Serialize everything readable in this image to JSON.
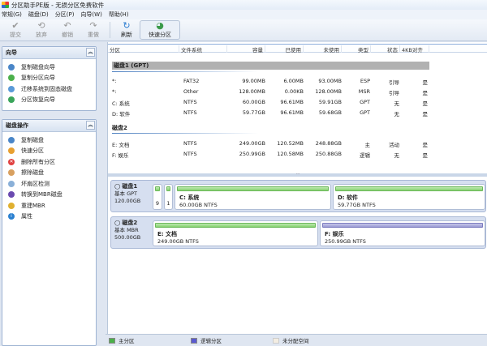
{
  "title": "分区助手PE版 - 无损分区免费软件",
  "menu": [
    "常规(G)",
    "磁盘(D)",
    "分区(P)",
    "向导(W)",
    "帮助(H)"
  ],
  "toolbar": {
    "commit": "提交",
    "discard": "放弃",
    "undo": "撤销",
    "redo": "重做",
    "refresh": "刷新",
    "quick": "快速分区"
  },
  "wizard": {
    "title": "向导",
    "items": [
      "复制磁盘向导",
      "复制分区向导",
      "迁移系统到固态磁盘",
      "分区恢复向导"
    ]
  },
  "diskops": {
    "title": "磁盘操作",
    "items": [
      "复制磁盘",
      "快速分区",
      "删除所有分区",
      "擦除磁盘",
      "坏扇区检测",
      "转换到MBR磁盘",
      "重建MBR",
      "属性"
    ]
  },
  "columns": [
    "分区",
    "文件系统",
    "容量",
    "已使用",
    "未使用",
    "类型",
    "状态",
    "4KB对齐"
  ],
  "disk1": {
    "header": "磁盘1 (GPT)",
    "rows": [
      [
        "*:",
        "FAT32",
        "99.00MB",
        "6.00MB",
        "93.00MB",
        "ESP",
        "引导",
        "是"
      ],
      [
        "*:",
        "Other",
        "128.00MB",
        "0.00KB",
        "128.00MB",
        "MSR",
        "引导",
        "是"
      ],
      [
        "C: 系统",
        "NTFS",
        "60.00GB",
        "96.61MB",
        "59.91GB",
        "GPT",
        "无",
        "是"
      ],
      [
        "D: 软件",
        "NTFS",
        "59.77GB",
        "96.61MB",
        "59.68GB",
        "GPT",
        "无",
        "是"
      ]
    ]
  },
  "disk2": {
    "header": "磁盘2",
    "rows": [
      [
        "E: 文档",
        "NTFS",
        "249.00GB",
        "120.52MB",
        "248.88GB",
        "主",
        "活动",
        "是"
      ],
      [
        "F: 娱乐",
        "NTFS",
        "250.99GB",
        "120.58MB",
        "250.88GB",
        "逻辑",
        "无",
        "是"
      ]
    ]
  },
  "map": {
    "disk1": {
      "name": "磁盘1",
      "type": "基本 GPT",
      "size": "120.00GB",
      "small1": "9",
      "small2": "1",
      "c": {
        "name": "C: 系统",
        "info": "60.00GB NTFS"
      },
      "d": {
        "name": "D: 软件",
        "info": "59.77GB NTFS"
      }
    },
    "disk2": {
      "name": "磁盘2",
      "type": "基本 MBR",
      "size": "500.00GB",
      "e": {
        "name": "E: 文档",
        "info": "249.00GB NTFS"
      },
      "f": {
        "name": "F: 娱乐",
        "info": "250.99GB NTFS"
      }
    }
  },
  "legend": {
    "primary": "主分区",
    "logical": "逻辑分区",
    "unallocated": "未分配空间"
  },
  "colors": {
    "primary": "#86d26f",
    "logical": "#9b9bd3",
    "unallocated": "#f3ede2"
  }
}
